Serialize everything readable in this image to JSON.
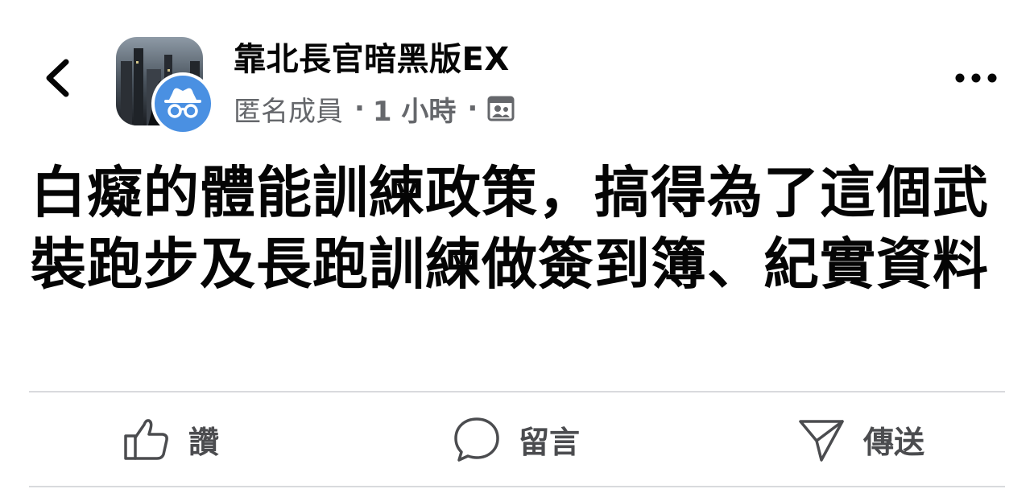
{
  "header": {
    "back_icon": "chevron-left-icon",
    "group_name": "靠北長官暗黑版EX",
    "author": "匿名成員",
    "separator": "·",
    "time": "1 小時",
    "privacy_icon": "group-members-icon",
    "more_icon": "more-horizontal-icon"
  },
  "post": {
    "text": "白癡的體能訓練政策，搞得為了這個武裝跑步及長跑訓練做簽到簿、紀實資料"
  },
  "actions": {
    "like_label": "讚",
    "comment_label": "留言",
    "share_label": "傳送"
  },
  "colors": {
    "text_primary": "#050505",
    "text_secondary": "#65676b",
    "anon_blue": "#4a90e2",
    "divider": "#d9dadd"
  }
}
